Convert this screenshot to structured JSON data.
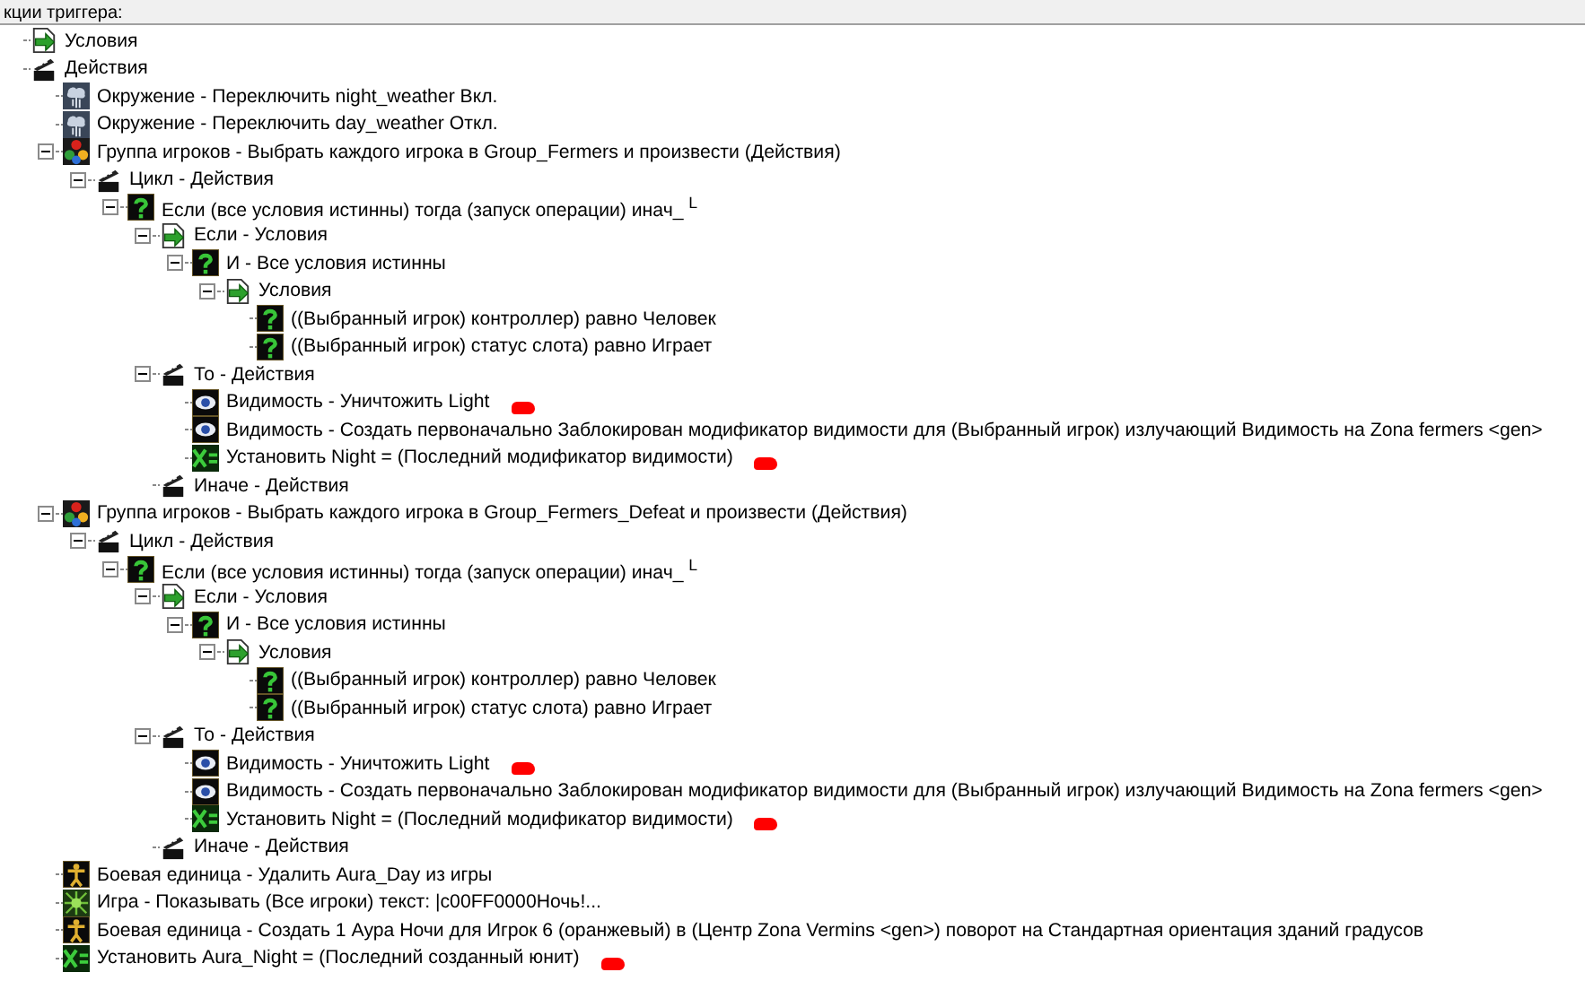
{
  "header": {
    "title": "кции триггера:"
  },
  "tree": [
    {
      "kind": "conditions",
      "label": "Условия"
    },
    {
      "kind": "actions",
      "label": "Действия",
      "children": [
        {
          "kind": "weather",
          "label": "Окружение - Переключить night_weather Вкл."
        },
        {
          "kind": "weather",
          "label": "Окружение - Переключить day_weather Откл."
        },
        {
          "kind": "player-group",
          "label": "Группа игроков - Выбрать каждого игрока в Group_Fermers и произвести (Действия)",
          "expanded": true,
          "children": [
            {
              "kind": "actions",
              "label": "Цикл - Действия",
              "expanded": true,
              "children": [
                {
                  "kind": "question",
                  "label": "Если (все условия истинны) тогда (запуск операции) инач_ $^{L}$",
                  "expanded": true,
                  "children": [
                    {
                      "kind": "conditions",
                      "label": "Если - Условия",
                      "expanded": true,
                      "children": [
                        {
                          "kind": "question",
                          "label": "И - Все условия истинны",
                          "expanded": true,
                          "children": [
                            {
                              "kind": "conditions",
                              "label": "Условия",
                              "expanded": true,
                              "children": [
                                {
                                  "kind": "question",
                                  "label": "((Выбранный игрок) контроллер) равно Человек"
                                },
                                {
                                  "kind": "question",
                                  "label": "((Выбранный игрок) статус слота) равно Играет"
                                }
                              ]
                            }
                          ]
                        }
                      ]
                    },
                    {
                      "kind": "actions",
                      "label": "То - Действия",
                      "expanded": true,
                      "children": [
                        {
                          "kind": "eye",
                          "label": "Видимость - Уничтожить Light",
                          "marked": true
                        },
                        {
                          "kind": "eye",
                          "label": "Видимость - Создать первоначально Заблокирован модификатор видимости для (Выбранный игрок) излучающий Видимость на Zona fermers <gen>"
                        },
                        {
                          "kind": "set-var",
                          "label": "Установить Night = (Последний модификатор видимости)",
                          "marked": true
                        }
                      ]
                    },
                    {
                      "kind": "actions",
                      "label": "Иначе - Действия"
                    }
                  ]
                }
              ]
            }
          ]
        },
        {
          "kind": "player-group",
          "label": "Группа игроков - Выбрать каждого игрока в Group_Fermers_Defeat и произвести (Действия)",
          "expanded": true,
          "children": [
            {
              "kind": "actions",
              "label": "Цикл - Действия",
              "expanded": true,
              "children": [
                {
                  "kind": "question",
                  "label": "Если (все условия истинны) тогда (запуск операции) инач_ $^{L}$",
                  "expanded": true,
                  "children": [
                    {
                      "kind": "conditions",
                      "label": "Если - Условия",
                      "expanded": true,
                      "children": [
                        {
                          "kind": "question",
                          "label": "И - Все условия истинны",
                          "expanded": true,
                          "children": [
                            {
                              "kind": "conditions",
                              "label": "Условия",
                              "expanded": true,
                              "children": [
                                {
                                  "kind": "question",
                                  "label": "((Выбранный игрок) контроллер) равно Человек"
                                },
                                {
                                  "kind": "question",
                                  "label": "((Выбранный игрок) статус слота) равно Играет"
                                }
                              ]
                            }
                          ]
                        }
                      ]
                    },
                    {
                      "kind": "actions",
                      "label": "То - Действия",
                      "expanded": true,
                      "children": [
                        {
                          "kind": "eye",
                          "label": "Видимость - Уничтожить Light",
                          "marked": true
                        },
                        {
                          "kind": "eye",
                          "label": "Видимость - Создать первоначально Заблокирован модификатор видимости для (Выбранный игрок) излучающий Видимость на Zona fermers <gen>"
                        },
                        {
                          "kind": "set-var",
                          "label": "Установить Night = (Последний модификатор видимости)",
                          "marked": true
                        }
                      ]
                    },
                    {
                      "kind": "actions",
                      "label": "Иначе - Действия"
                    }
                  ]
                }
              ]
            }
          ]
        },
        {
          "kind": "unit",
          "label": "Боевая единица - Удалить Aura_Day из игры"
        },
        {
          "kind": "game",
          "label": "Игра - Показывать (Все игроки) текст: |c00FF0000Ночь!..."
        },
        {
          "kind": "unit",
          "label": "Боевая единица - Создать 1 Аура Ночи для Игрок 6 (оранжевый) в (Центр Zona Vermins <gen>) поворот на Стандартная ориентация зданий градусов"
        },
        {
          "kind": "set-var",
          "label": "Установить Aura_Night = (Последний созданный юнит)",
          "marked": true
        }
      ]
    }
  ]
}
